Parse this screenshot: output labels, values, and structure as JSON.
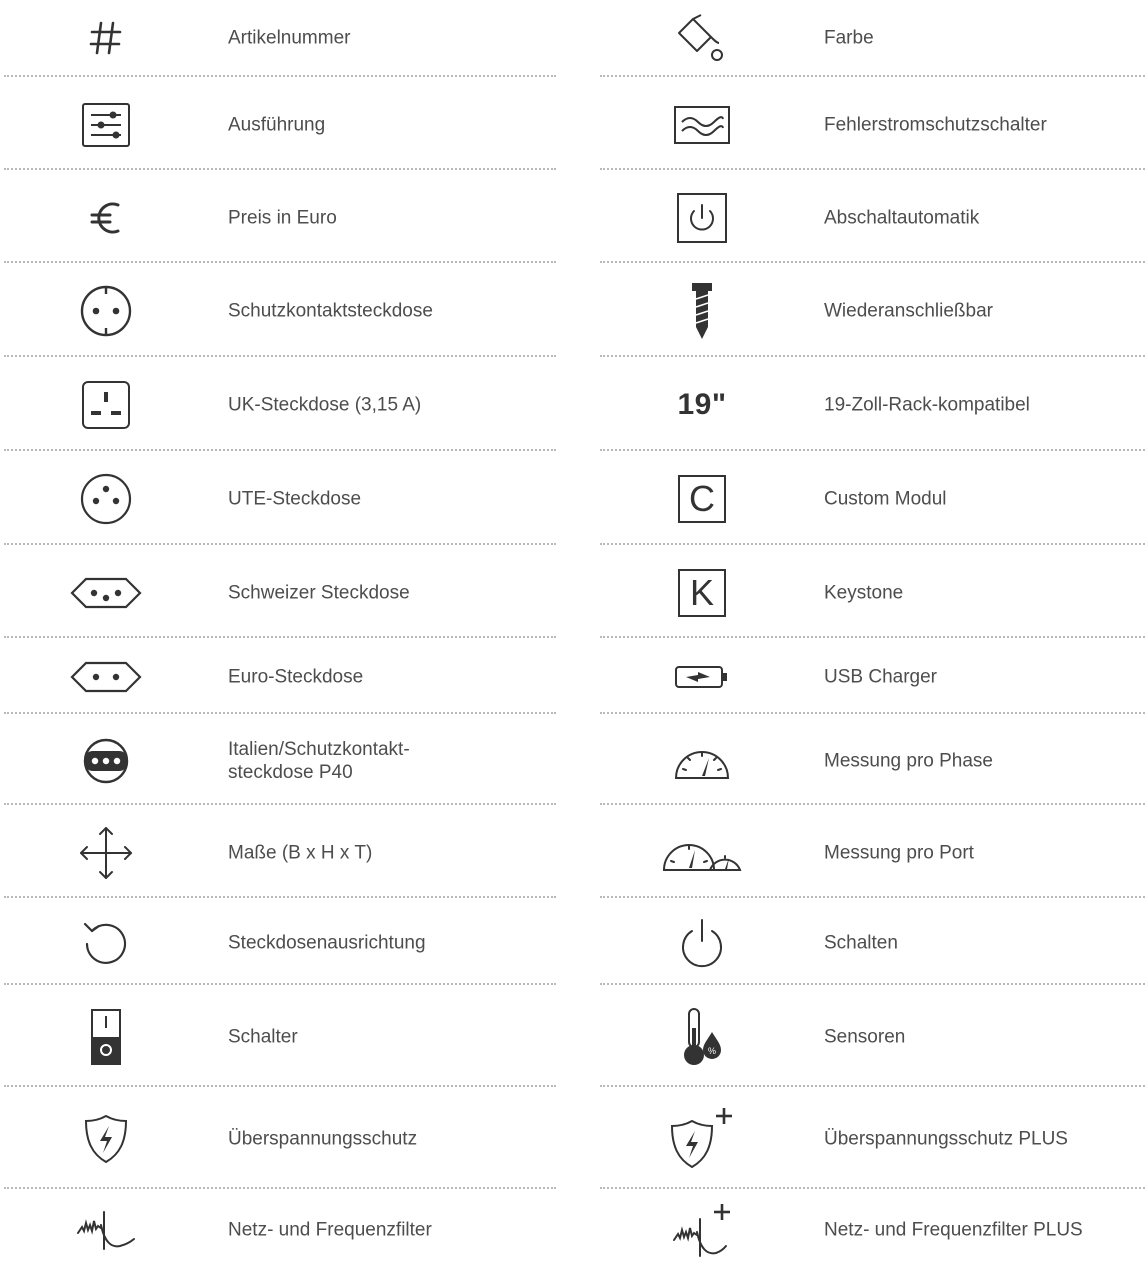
{
  "left_column": {
    "items": [
      {
        "icon": "hash-icon",
        "label": "Artikelnummer"
      },
      {
        "icon": "sliders-icon",
        "label": "Ausführung"
      },
      {
        "icon": "euro-icon",
        "label": "Preis in Euro"
      },
      {
        "icon": "schuko-socket-icon",
        "label": "Schutzkontaktsteckdose"
      },
      {
        "icon": "uk-socket-icon",
        "label": "UK-Steckdose (3,15 A)"
      },
      {
        "icon": "ute-socket-icon",
        "label": "UTE-Steckdose"
      },
      {
        "icon": "swiss-socket-icon",
        "label": "Schweizer Steckdose"
      },
      {
        "icon": "euro-socket-icon",
        "label": "Euro-Steckdose"
      },
      {
        "icon": "italian-schuko-socket-icon",
        "label": "Italien/Schutzkontakt-\nsteckdose P40"
      },
      {
        "icon": "dimensions-arrows-icon",
        "label": "Maße (B x H x T)"
      },
      {
        "icon": "rotate-icon",
        "label": "Steckdosenausrichtung"
      },
      {
        "icon": "rocker-switch-icon",
        "label": "Schalter"
      },
      {
        "icon": "surge-shield-icon",
        "label": "Überspannungsschutz"
      },
      {
        "icon": "filter-wave-icon",
        "label": "Netz- und Frequenzfilter"
      }
    ]
  },
  "right_column": {
    "items": [
      {
        "icon": "paint-bucket-icon",
        "label": "Farbe"
      },
      {
        "icon": "rcd-wave-icon",
        "label": "Fehlerstromschutzschalter"
      },
      {
        "icon": "auto-shutoff-power-icon",
        "label": "Abschaltautomatik"
      },
      {
        "icon": "screw-icon",
        "label": "Wiederanschließbar"
      },
      {
        "icon": "rack-19-icon",
        "icon_text": "19\"",
        "label": "19-Zoll-Rack-kompatibel"
      },
      {
        "icon": "custom-module-icon",
        "icon_text": "C",
        "label": "Custom Modul"
      },
      {
        "icon": "keystone-icon",
        "icon_text": "K",
        "label": "Keystone"
      },
      {
        "icon": "usb-charger-battery-icon",
        "label": "USB Charger"
      },
      {
        "icon": "gauge-icon",
        "label": "Messung pro Phase"
      },
      {
        "icon": "double-gauge-icon",
        "label": "Messung pro Port"
      },
      {
        "icon": "power-icon",
        "label": "Schalten"
      },
      {
        "icon": "thermometer-humidity-icon",
        "label": "Sensoren"
      },
      {
        "icon": "surge-shield-plus-icon",
        "label": "Überspannungsschutz PLUS"
      },
      {
        "icon": "filter-wave-plus-icon",
        "label": "Netz- und Frequenzfilter PLUS"
      }
    ]
  },
  "colors": {
    "text": "#4d4d4d",
    "icon": "#333333",
    "separator": "#b9b9b9"
  }
}
